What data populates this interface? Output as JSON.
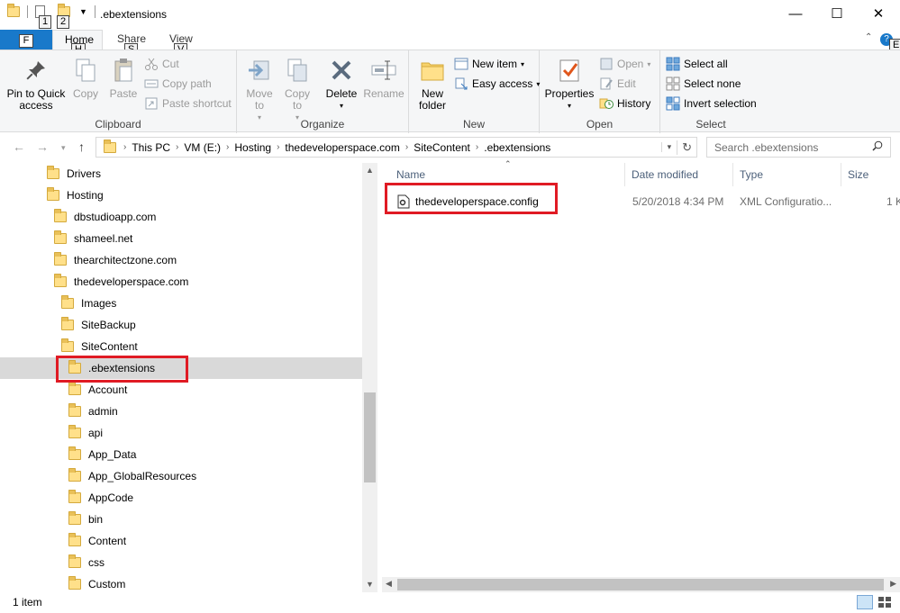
{
  "window": {
    "title": ".ebextensions",
    "minimize": "—",
    "maximize": "☐",
    "close": "✕"
  },
  "keytips": {
    "qat1": "1",
    "qat2": "2",
    "file": "F",
    "home": "H",
    "share": "S",
    "view": "V",
    "help": "E"
  },
  "tabs": {
    "file": "File",
    "home": "Home",
    "share": "Share",
    "view": "View"
  },
  "ribbon": {
    "clipboard": {
      "label": "Clipboard",
      "pin": "Pin to Quick access",
      "copy": "Copy",
      "paste": "Paste",
      "cut": "Cut",
      "copy_path": "Copy path",
      "paste_shortcut": "Paste shortcut"
    },
    "organize": {
      "label": "Organize",
      "move_to": "Move to",
      "copy_to": "Copy to",
      "delete": "Delete",
      "rename": "Rename"
    },
    "new": {
      "label": "New",
      "new_folder": "New folder",
      "new_item": "New item",
      "easy_access": "Easy access"
    },
    "open": {
      "label": "Open",
      "properties": "Properties",
      "open": "Open",
      "edit": "Edit",
      "history": "History"
    },
    "select": {
      "label": "Select",
      "select_all": "Select all",
      "select_none": "Select none",
      "invert": "Invert selection"
    }
  },
  "address": {
    "crumbs": [
      "This PC",
      "VM (E:)",
      "Hosting",
      "thedeveloperspace.com",
      "SiteContent",
      ".ebextensions"
    ],
    "search_placeholder": "Search .ebextensions"
  },
  "nav_tree": [
    {
      "label": "Drivers"
    },
    {
      "label": "Hosting"
    },
    {
      "label": "dbstudioapp.com"
    },
    {
      "label": "shameel.net"
    },
    {
      "label": "thearchitectzone.com"
    },
    {
      "label": "thedeveloperspace.com"
    },
    {
      "label": "Images"
    },
    {
      "label": "SiteBackup"
    },
    {
      "label": "SiteContent"
    },
    {
      "label": ".ebextensions"
    },
    {
      "label": "Account"
    },
    {
      "label": "admin"
    },
    {
      "label": "api"
    },
    {
      "label": "App_Data"
    },
    {
      "label": "App_GlobalResources"
    },
    {
      "label": "AppCode"
    },
    {
      "label": "bin"
    },
    {
      "label": "Content"
    },
    {
      "label": "css"
    },
    {
      "label": "Custom"
    }
  ],
  "columns": {
    "name": "Name",
    "date_modified": "Date modified",
    "type": "Type",
    "size": "Size"
  },
  "files": [
    {
      "name": "thedeveloperspace.config",
      "date_modified": "5/20/2018 4:34 PM",
      "type": "XML Configuratio...",
      "size": "1 K"
    }
  ],
  "status": {
    "item_count": "1 item"
  },
  "colors": {
    "accent": "#1979ca",
    "highlight": "#e01b24",
    "selection": "#d9d9d9"
  }
}
